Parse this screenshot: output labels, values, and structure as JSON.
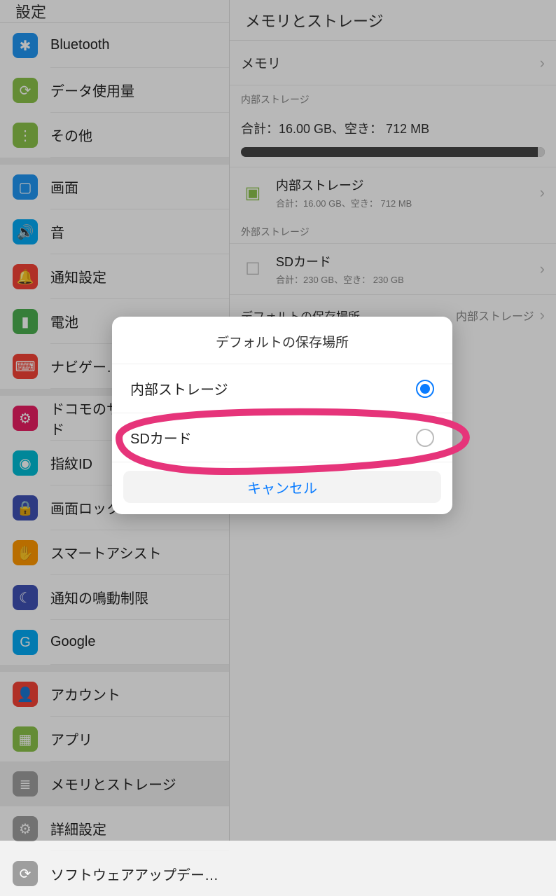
{
  "left": {
    "title": "設定",
    "items": [
      {
        "label": "Bluetooth",
        "color": "#2196f3",
        "glyph": "✱"
      },
      {
        "label": "データ使用量",
        "color": "#8bc34a",
        "glyph": "⟳"
      },
      {
        "label": "その他",
        "color": "#8bc34a",
        "glyph": "⋮"
      }
    ],
    "group2": [
      {
        "label": "画面",
        "color": "#2196f3",
        "glyph": "▢"
      },
      {
        "label": "音",
        "color": "#03a9f4",
        "glyph": "🔊"
      },
      {
        "label": "通知設定",
        "color": "#f44336",
        "glyph": "🔔"
      },
      {
        "label": "電池",
        "color": "#4caf50",
        "glyph": "▮"
      },
      {
        "label": "ナビゲー…",
        "color": "#f44336",
        "glyph": "⌨"
      }
    ],
    "group3": [
      {
        "label": "ドコモのサービス/クラウド",
        "color": "#e91e63",
        "glyph": "⚙"
      },
      {
        "label": "指紋ID",
        "color": "#00bcd4",
        "glyph": "◉"
      },
      {
        "label": "画面ロック…",
        "color": "#3f51b5",
        "glyph": "🔒"
      },
      {
        "label": "スマートアシスト",
        "color": "#ff9800",
        "glyph": "✋"
      },
      {
        "label": "通知の鳴動制限",
        "color": "#3f51b5",
        "glyph": "☾"
      },
      {
        "label": "Google",
        "color": "#03a9f4",
        "glyph": "G"
      }
    ],
    "group4": [
      {
        "label": "アカウント",
        "color": "#f44336",
        "glyph": "👤"
      },
      {
        "label": "アプリ",
        "color": "#8bc34a",
        "glyph": "▦"
      },
      {
        "label": "メモリとストレージ",
        "color": "#9e9e9e",
        "glyph": "≣",
        "selected": true
      },
      {
        "label": "詳細設定",
        "color": "#9e9e9e",
        "glyph": "⚙"
      },
      {
        "label": "ソフトウェアアップデー…",
        "color": "#9e9e9e",
        "glyph": "⟳"
      }
    ]
  },
  "right": {
    "title": "メモリとストレージ",
    "memory_label": "メモリ",
    "internal_header": "内部ストレージ",
    "summary": "合計：16.00 GB、空き： 712 MB",
    "internal": {
      "title": "内部ストレージ",
      "sub": "合計：16.00 GB、空き： 712 MB"
    },
    "external_header": "外部ストレージ",
    "sd": {
      "title": "SDカード",
      "sub": "合計：230 GB、空き： 230 GB"
    },
    "default_label": "デフォルトの保存場所",
    "default_value": "内部ストレージ"
  },
  "dialog": {
    "title": "デフォルトの保存場所",
    "options": [
      {
        "label": "内部ストレージ",
        "checked": true
      },
      {
        "label": "SDカード",
        "checked": false
      }
    ],
    "cancel": "キャンセル"
  }
}
